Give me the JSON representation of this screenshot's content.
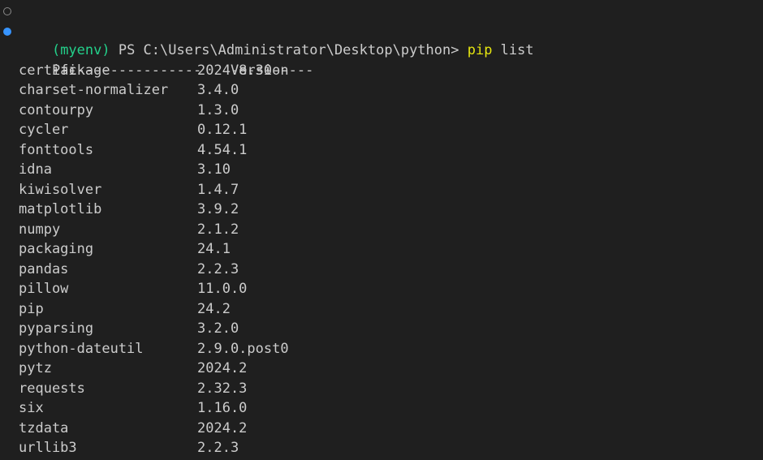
{
  "prompt": {
    "venv": "(myenv)",
    "text": " PS C:\\Users\\Administrator\\Desktop\\python> ",
    "command": "pip",
    "argument": " list"
  },
  "header": {
    "package": "Package",
    "version": "Version"
  },
  "separator": {
    "package": "------------------",
    "version": "----------"
  },
  "packages": [
    {
      "name": "certifi",
      "version": "2024.8.30"
    },
    {
      "name": "charset-normalizer",
      "version": "3.4.0"
    },
    {
      "name": "contourpy",
      "version": "1.3.0"
    },
    {
      "name": "cycler",
      "version": "0.12.1"
    },
    {
      "name": "fonttools",
      "version": "4.54.1"
    },
    {
      "name": "idna",
      "version": "3.10"
    },
    {
      "name": "kiwisolver",
      "version": "1.4.7"
    },
    {
      "name": "matplotlib",
      "version": "3.9.2"
    },
    {
      "name": "numpy",
      "version": "2.1.2"
    },
    {
      "name": "packaging",
      "version": "24.1"
    },
    {
      "name": "pandas",
      "version": "2.2.3"
    },
    {
      "name": "pillow",
      "version": "11.0.0"
    },
    {
      "name": "pip",
      "version": "24.2"
    },
    {
      "name": "pyparsing",
      "version": "3.2.0"
    },
    {
      "name": "python-dateutil",
      "version": "2.9.0.post0"
    },
    {
      "name": "pytz",
      "version": "2024.2"
    },
    {
      "name": "requests",
      "version": "2.32.3"
    },
    {
      "name": "six",
      "version": "1.16.0"
    },
    {
      "name": "tzdata",
      "version": "2024.2"
    },
    {
      "name": "urllib3",
      "version": "2.2.3"
    }
  ],
  "colors": {
    "background": "#1f1f1f",
    "foreground": "#cccccc",
    "venv": "#23d18b",
    "command": "#e5e510",
    "decoration_success": "#3794ff"
  },
  "icons": {
    "prompt_decoration": "circle-outline-icon",
    "command_decoration": "circle-filled-icon"
  }
}
